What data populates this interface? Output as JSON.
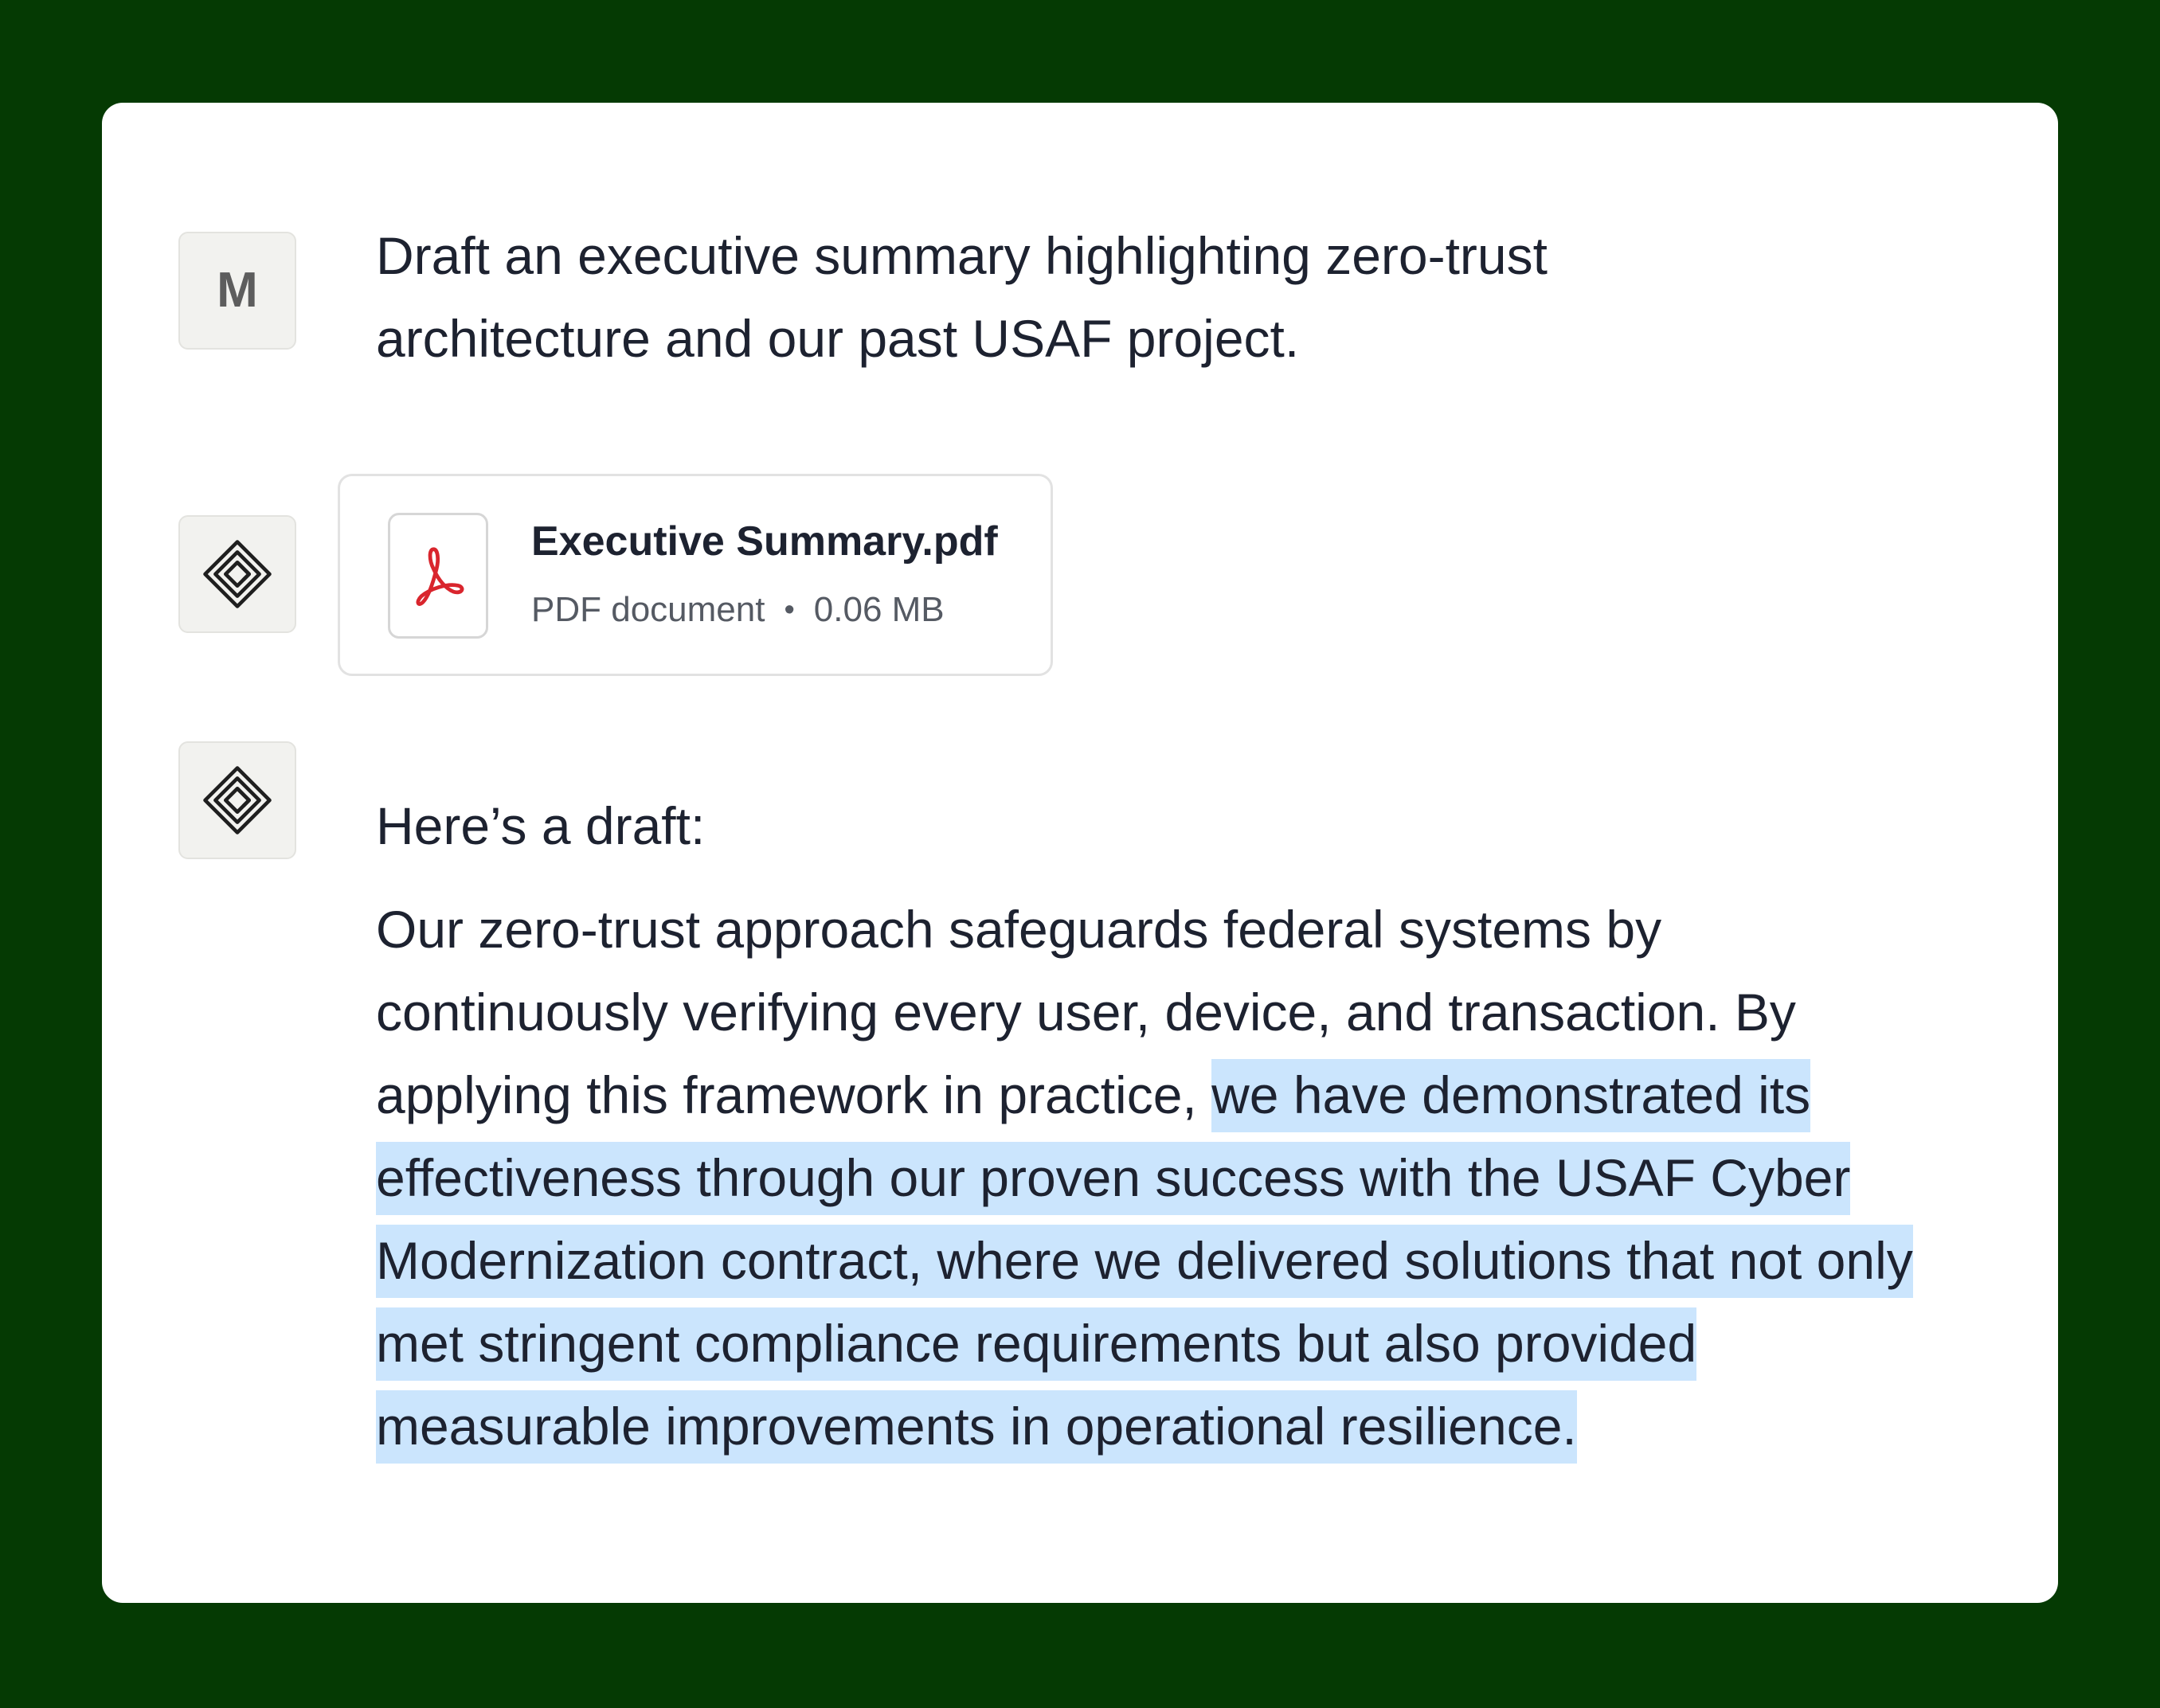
{
  "conversation": {
    "user_message": {
      "avatar_letter": "M",
      "text": "Draft an executive summary highlighting zero-trust architecture and our past USAF project."
    },
    "attachment": {
      "avatar_icon": "assistant-logo-icon",
      "file_icon": "pdf-icon",
      "file_name": "Executive Summary.pdf",
      "file_type": "PDF document",
      "separator": "•",
      "file_size": "0.06 MB"
    },
    "assistant_reply": {
      "avatar_icon": "assistant-logo-icon",
      "intro": "Here’s a draft:",
      "body_plain": "Our zero-trust approach safeguards federal systems by continuously verifying every user, device, and transaction. By applying this framework in practice, ",
      "body_highlighted": "we have demonstrated its effectiveness through our proven success with the USAF Cyber Modernization contract, where we delivered solutions that not only met stringent compliance requirements but also provided measurable improvements in operational resilience."
    }
  },
  "colors": {
    "background": "#053a03",
    "card": "#ffffff",
    "avatar_bg": "#f2f2ef",
    "highlight": "#cbe5fd",
    "text": "#1d2230",
    "pdf_red": "#d9252d"
  }
}
